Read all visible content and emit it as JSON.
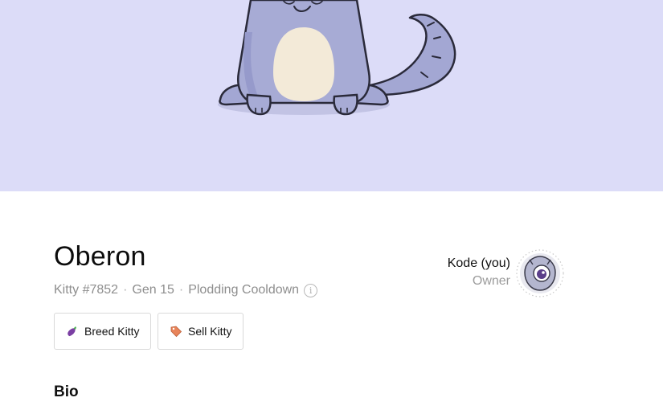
{
  "kitty": {
    "name": "Oberon",
    "id_label": "Kitty #7852",
    "generation": "Gen 15",
    "cooldown": "Plodding Cooldown"
  },
  "actions": {
    "breed_label": "Breed Kitty",
    "sell_label": "Sell Kitty"
  },
  "owner": {
    "name": "Kode (you)",
    "role": "Owner"
  },
  "sections": {
    "bio_heading": "Bio"
  },
  "icons": {
    "breed": "eggplant-icon",
    "sell": "price-tag-icon",
    "info": "info-icon"
  },
  "colors": {
    "hero_background": "#dcdcf8",
    "cat_body": "#a7abd5",
    "cat_belly": "#f3ead8"
  }
}
